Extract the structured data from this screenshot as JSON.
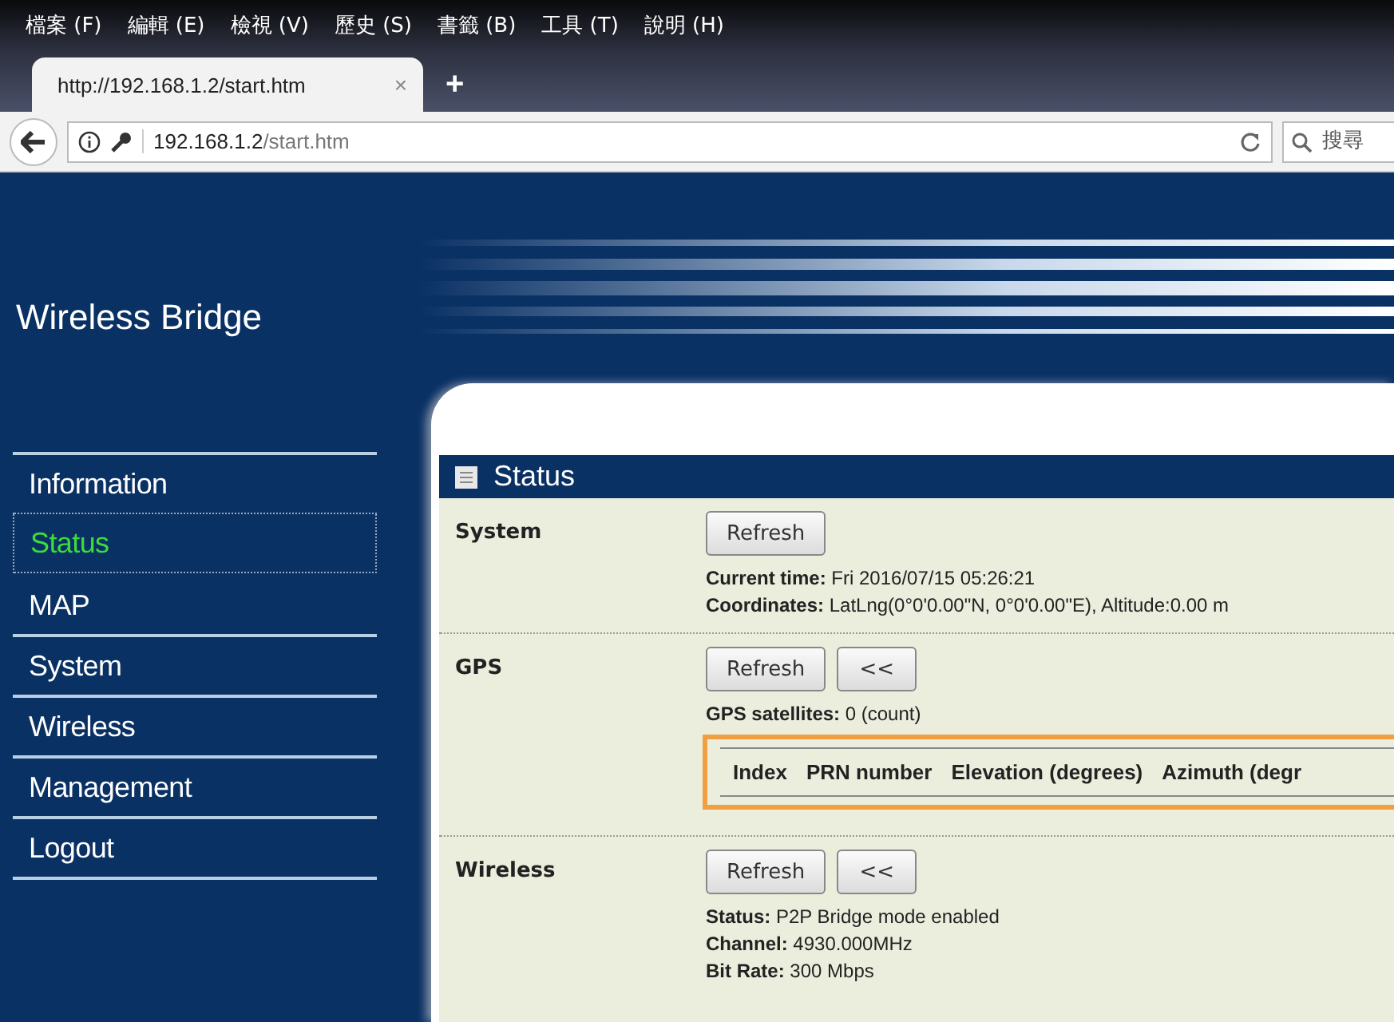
{
  "menu_bar": [
    "檔案 (F)",
    "編輯 (E)",
    "檢視 (V)",
    "歷史 (S)",
    "書籤 (B)",
    "工具 (T)",
    "說明 (H)"
  ],
  "tabs": [
    {
      "title": "http://192.168.1.2/start.htm",
      "selected": true,
      "close": "×"
    }
  ],
  "new_tab": "+",
  "address_bar": {
    "host": "192.168.1.2",
    "path": "/start.htm"
  },
  "search": {
    "placeholder": "搜尋"
  },
  "site_title": "Wireless Bridge",
  "sidebar": {
    "items": [
      {
        "label": "Information",
        "selected": false
      },
      {
        "label": "Status",
        "selected": true
      },
      {
        "label": "MAP",
        "selected": false
      },
      {
        "label": "System",
        "selected": false
      },
      {
        "label": "Wireless",
        "selected": false
      },
      {
        "label": "Management",
        "selected": false
      },
      {
        "label": "Logout",
        "selected": false
      }
    ]
  },
  "panel": {
    "title": "Status",
    "sections": [
      {
        "label": "System",
        "buttons": [
          "Refresh"
        ],
        "lines": [
          "**Current time:** Fri 2016/07/15 05:26:21",
          "**Coordinates:** LatLng(0°0'0.00\"N, 0°0'0.00\"E), Altitude:0.00 m"
        ]
      },
      {
        "label": "GPS",
        "buttons": [
          "Refresh",
          "<<"
        ],
        "lines": [
          "**GPS satellites:** 0 (count)"
        ],
        "table": {
          "columns": [
            "Index",
            "PRN number",
            "Elevation (degrees)",
            "Azimuth (degr"
          ]
        }
      },
      {
        "label": "Wireless",
        "buttons": [
          "Refresh",
          "<<"
        ],
        "lines": [
          "**Status:** P2P Bridge mode enabled",
          "**Channel:** 4930.000MHz",
          "**Bit Rate:** 300 Mbps"
        ]
      }
    ]
  }
}
